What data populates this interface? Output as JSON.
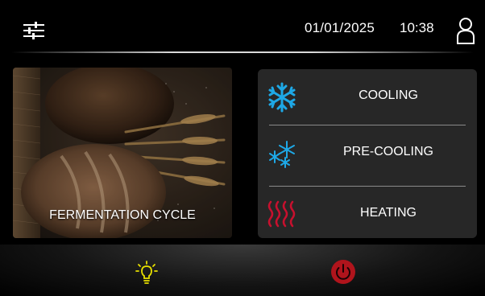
{
  "header": {
    "date": "01/01/2025",
    "time": "10:38",
    "settings_icon": "sliders-icon",
    "user_icon": "user-icon"
  },
  "main": {
    "fermentation_tile": {
      "label": "FERMENTATION CYCLE"
    },
    "modes": [
      {
        "label": "COOLING",
        "icon": "snowflake-icon",
        "color": "#1ea8e6"
      },
      {
        "label": "PRE-COOLING",
        "icon": "small-snowflakes-icon",
        "color": "#1ea8e6"
      },
      {
        "label": "HEATING",
        "icon": "heat-waves-icon",
        "color": "#c8102e"
      }
    ]
  },
  "footer": {
    "light_icon": "lightbulb-icon",
    "light_color": "#e8e000",
    "power_icon": "power-icon",
    "power_color": "#b0141c"
  }
}
